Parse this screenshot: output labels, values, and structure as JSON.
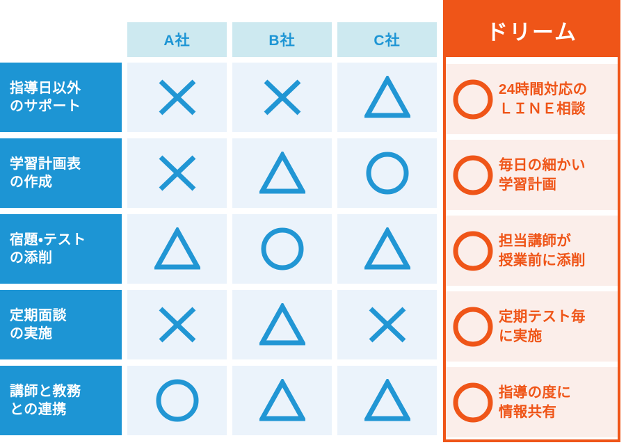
{
  "table": {
    "competitor_headers": [
      {
        "label": "A社"
      },
      {
        "label": "B社"
      },
      {
        "label": "C社"
      }
    ],
    "highlight_header": "ドリーム",
    "rows": [
      {
        "label": "指導日以外\nのサポート",
        "marks": [
          "cross",
          "cross",
          "triangle"
        ],
        "highlight_mark": "circle",
        "highlight_text": "24時間対応の\nＬＩＮＥ相談"
      },
      {
        "label": "学習計画表\nの作成",
        "marks": [
          "cross",
          "triangle",
          "circle"
        ],
        "highlight_mark": "circle",
        "highlight_text": "毎日の細かい\n学習計画"
      },
      {
        "label": "宿題・テスト\nの添削",
        "marks": [
          "triangle",
          "circle",
          "triangle"
        ],
        "highlight_mark": "circle",
        "highlight_text": "担当講師が\n授業前に添削"
      },
      {
        "label": "定期面談\nの実施",
        "marks": [
          "cross",
          "triangle",
          "cross"
        ],
        "highlight_mark": "circle",
        "highlight_text": "定期テスト毎\nに実施"
      },
      {
        "label": "講師と教務\nとの連携",
        "marks": [
          "circle",
          "triangle",
          "triangle"
        ],
        "highlight_mark": "circle",
        "highlight_text": "指導の度に\n情報共有"
      }
    ]
  },
  "icons": {
    "circle": "circle-mark-icon",
    "triangle": "triangle-mark-icon",
    "cross": "cross-mark-icon",
    "highlight_circle": "orange-circle-mark-icon"
  },
  "colors": {
    "competitor_header_bg": "#cde9f0",
    "competitor_header_text": "#1d95d4",
    "row_label_bg": "#1d95d4",
    "row_label_text": "#ffffff",
    "mark_cell_bg": "#ebf3fb",
    "mark_stroke": "#2196d4",
    "highlight_accent": "#ef5518",
    "highlight_row_bg": "#fbeeea"
  }
}
